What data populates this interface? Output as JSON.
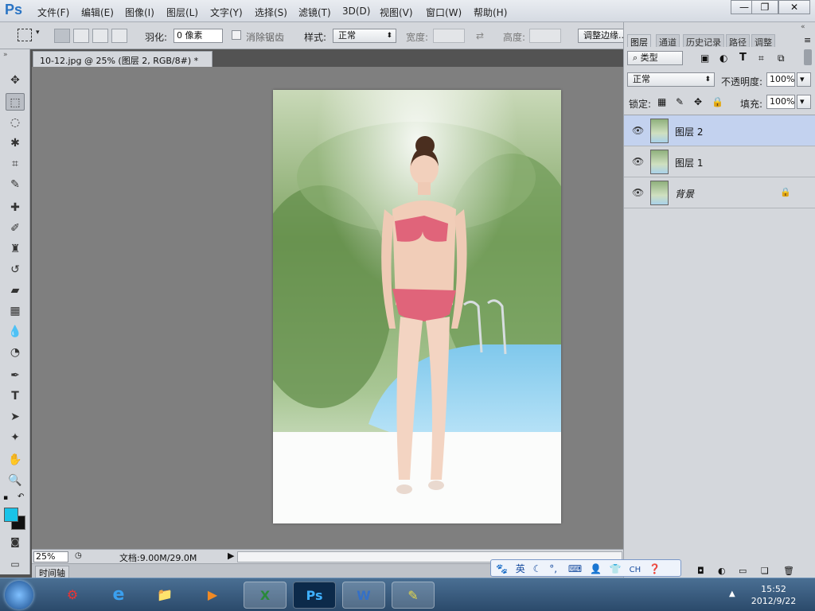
{
  "app": {
    "logo": "Ps",
    "menus": [
      "文件(F)",
      "编辑(E)",
      "图像(I)",
      "图层(L)",
      "文字(Y)",
      "选择(S)",
      "滤镜(T)",
      "3D(D)",
      "视图(V)",
      "窗口(W)",
      "帮助(H)"
    ],
    "window_buttons": [
      "—",
      "❐",
      "✕"
    ]
  },
  "options": {
    "feather_label": "羽化:",
    "feather_value": "0 像素",
    "antialias_label": "消除锯齿",
    "style_label": "样式:",
    "style_value": "正常",
    "width_label": "宽度:",
    "height_label": "高度:",
    "refine_edge": "调整边缘..."
  },
  "document": {
    "tab_title": "10-12.jpg @ 25% (图层 2, RGB/8#) *",
    "tab_close": "×",
    "zoom": "25%",
    "doc_info": "文档:9.00M/29.0M",
    "timeline_label": "时间轴"
  },
  "panel": {
    "tabs": [
      "图层",
      "通道",
      "历史记录",
      "路径",
      "调整"
    ],
    "filter_type": "类型",
    "blend_mode": "正常",
    "opacity_label": "不透明度:",
    "opacity_value": "100%",
    "lock_label": "锁定:",
    "fill_label": "填充:",
    "fill_value": "100%",
    "layers": [
      {
        "name": "图层 2",
        "selected": true,
        "locked": false
      },
      {
        "name": "图层 1",
        "selected": false,
        "locked": false
      },
      {
        "name": "背景",
        "selected": false,
        "locked": true
      }
    ]
  },
  "ime": {
    "lang": "英"
  },
  "taskbar": {
    "clock_time": "15:52",
    "clock_date": "2012/9/22",
    "apps": [
      "ie",
      "explorer",
      "media",
      "excel",
      "photoshop",
      "word",
      "notes"
    ]
  },
  "colors": {
    "foreground": "#19c3e8",
    "background": "#111111"
  }
}
